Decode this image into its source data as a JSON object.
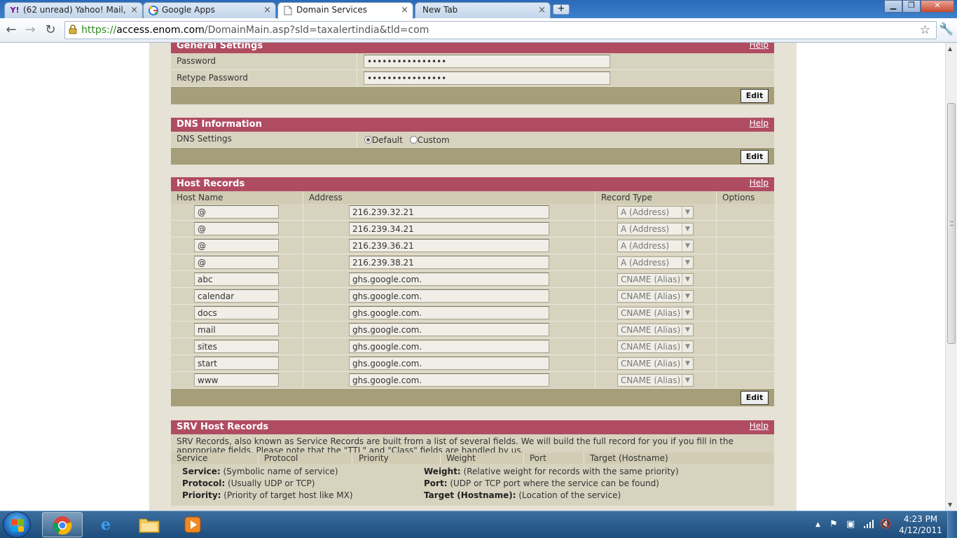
{
  "browser": {
    "tabs": [
      {
        "label": "(62 unread) Yahoo! Mail, ...",
        "icon": "Y!",
        "icon_color": "#7b0099"
      },
      {
        "label": "Google Apps",
        "icon": "g",
        "icon_color": "#2f7bd8"
      },
      {
        "label": "Domain Services",
        "icon": "doc",
        "icon_color": "#666666"
      },
      {
        "label": "New Tab",
        "icon": "",
        "icon_color": ""
      }
    ],
    "new_tab_label": "+",
    "tab_close": "×",
    "url": {
      "scheme": "https://",
      "host": "access.enom.com",
      "path": "/DomainMain.asp?sld=taxalertindia&tld=com"
    }
  },
  "general_settings": {
    "title": "General Settings",
    "help": "Help",
    "password_label": "Password",
    "password_value": "••••••••••••••••",
    "retype_label": "Retype Password",
    "retype_value": "••••••••••••••••",
    "edit": "Edit"
  },
  "dns_information": {
    "title": "DNS Information",
    "help": "Help",
    "settings_label": "DNS Settings",
    "option_default": "Default",
    "option_custom": "Custom",
    "selected": "Default",
    "edit": "Edit"
  },
  "host_records": {
    "title": "Host Records",
    "help": "Help",
    "columns": [
      "Host Name",
      "Address",
      "Record Type",
      "Options"
    ],
    "rows": [
      {
        "host": "@",
        "address": "216.239.32.21",
        "type": "A (Address)"
      },
      {
        "host": "@",
        "address": "216.239.34.21",
        "type": "A (Address)"
      },
      {
        "host": "@",
        "address": "216.239.36.21",
        "type": "A (Address)"
      },
      {
        "host": "@",
        "address": "216.239.38.21",
        "type": "A (Address)"
      },
      {
        "host": "abc",
        "address": "ghs.google.com.",
        "type": "CNAME (Alias)"
      },
      {
        "host": "calendar",
        "address": "ghs.google.com.",
        "type": "CNAME (Alias)"
      },
      {
        "host": "docs",
        "address": "ghs.google.com.",
        "type": "CNAME (Alias)"
      },
      {
        "host": "mail",
        "address": "ghs.google.com.",
        "type": "CNAME (Alias)"
      },
      {
        "host": "sites",
        "address": "ghs.google.com.",
        "type": "CNAME (Alias)"
      },
      {
        "host": "start",
        "address": "ghs.google.com.",
        "type": "CNAME (Alias)"
      },
      {
        "host": "www",
        "address": "ghs.google.com.",
        "type": "CNAME (Alias)"
      }
    ],
    "edit": "Edit"
  },
  "srv_records": {
    "title": "SRV Host Records",
    "help": "Help",
    "description": "SRV Records, also known as Service Records are built from a list of several fields. We will build the full record for you if you fill in the appropriate fields. Please note that the \"TTL\" and \"Class\" fields are handled by us.",
    "columns": [
      "Service",
      "Protocol",
      "Priority",
      "Weight",
      "Port",
      "Target (Hostname)"
    ],
    "legend": {
      "service_term": "Service:",
      "service_desc": " (Symbolic name of service)",
      "protocol_term": "Protocol:",
      "protocol_desc": " (Usually UDP or TCP)",
      "priority_term": "Priority:",
      "priority_desc": " (Priority of target host like MX)",
      "weight_term": "Weight:",
      "weight_desc": " (Relative weight for records with the same priority)",
      "port_term": "Port:",
      "port_desc": " (UDP or TCP port where the service can be found)",
      "target_term": "Target (Hostname):",
      "target_desc": " (Location of the service)"
    }
  },
  "taskbar": {
    "time": "4:23 PM",
    "date": "4/12/2011"
  },
  "colors": {
    "panel_header": "#b04c62",
    "row_bg": "#d8d3bf",
    "footer_bar": "#a59e79",
    "page_bg": "#e6e2d5"
  }
}
